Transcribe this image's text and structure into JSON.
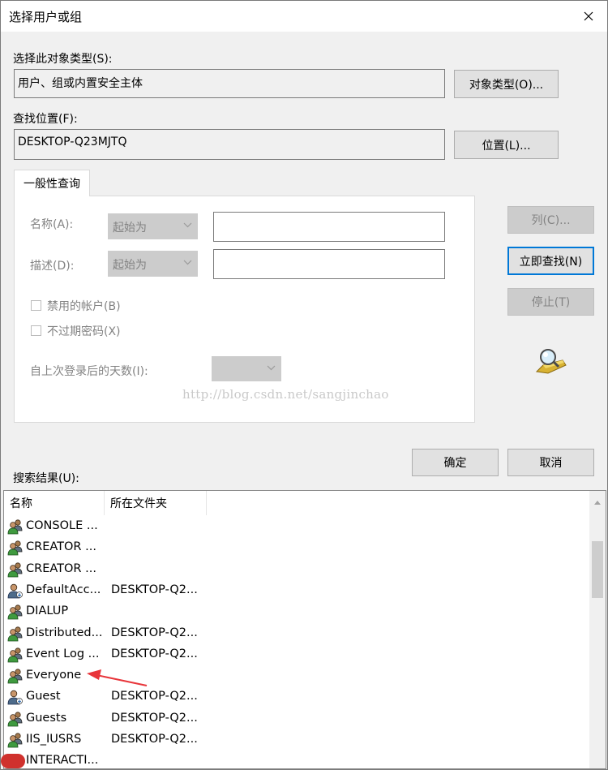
{
  "window": {
    "title": "选择用户或组"
  },
  "object_type": {
    "label": "选择此对象类型(S):",
    "value": "用户、组或内置安全主体",
    "button": "对象类型(O)..."
  },
  "location": {
    "label": "查找位置(F):",
    "value": "DESKTOP-Q23MJTQ",
    "button": "位置(L)..."
  },
  "query": {
    "tab": "一般性查询",
    "name_label": "名称(A):",
    "name_mode": "起始为",
    "desc_label": "描述(D):",
    "desc_mode": "起始为",
    "disabled_accounts": "禁用的帐户(B)",
    "non_expiring": "不过期密码(X)",
    "days_label": "自上次登录后的天数(I):"
  },
  "side_buttons": {
    "columns": "列(C)...",
    "find_now": "立即查找(N)",
    "stop": "停止(T)"
  },
  "watermark": "http://blog.csdn.net/sangjinchao",
  "ok": "确定",
  "cancel": "取消",
  "results": {
    "label": "搜索结果(U):",
    "columns": [
      "名称",
      "所在文件夹"
    ],
    "rows": [
      {
        "name": "CONSOLE ...",
        "folder": "",
        "icon": "group"
      },
      {
        "name": "CREATOR ...",
        "folder": "",
        "icon": "group"
      },
      {
        "name": "CREATOR ...",
        "folder": "",
        "icon": "group"
      },
      {
        "name": "DefaultAcc...",
        "folder": "DESKTOP-Q2...",
        "icon": "user"
      },
      {
        "name": "DIALUP",
        "folder": "",
        "icon": "group"
      },
      {
        "name": "Distributed...",
        "folder": "DESKTOP-Q2...",
        "icon": "group"
      },
      {
        "name": "Event Log ...",
        "folder": "DESKTOP-Q2...",
        "icon": "group"
      },
      {
        "name": "Everyone",
        "folder": "",
        "icon": "group"
      },
      {
        "name": "Guest",
        "folder": "DESKTOP-Q2...",
        "icon": "user"
      },
      {
        "name": "Guests",
        "folder": "DESKTOP-Q2...",
        "icon": "group"
      },
      {
        "name": "IIS_IUSRS",
        "folder": "DESKTOP-Q2...",
        "icon": "group"
      },
      {
        "name": "INTERACTI...",
        "folder": "",
        "icon": "group"
      }
    ]
  },
  "colors": {
    "accent": "#0078d7",
    "annotation_arrow": "#e8353a"
  }
}
